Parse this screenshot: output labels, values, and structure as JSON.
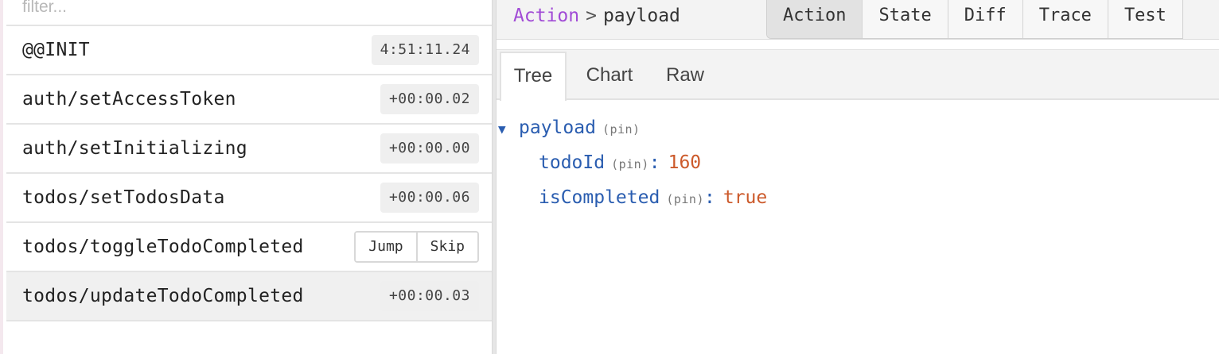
{
  "filter": {
    "placeholder": "filter..."
  },
  "actions": [
    {
      "name": "@@INIT",
      "time": "4:51:11.24"
    },
    {
      "name": "auth/setAccessToken",
      "time": "+00:00.02"
    },
    {
      "name": "auth/setInitializing",
      "time": "+00:00.00"
    },
    {
      "name": "todos/setTodosData",
      "time": "+00:00.06"
    },
    {
      "name": "todos/toggleTodoCompleted",
      "jump_label": "Jump",
      "skip_label": "Skip"
    },
    {
      "name": "todos/updateTodoCompleted",
      "time": "+00:00.03"
    }
  ],
  "breadcrumb": {
    "root": "Action",
    "separator": ">",
    "current": "payload"
  },
  "monitor_tabs": [
    "Action",
    "State",
    "Diff",
    "Trace",
    "Test"
  ],
  "sub_tabs": [
    "Tree",
    "Chart",
    "Raw"
  ],
  "tree": {
    "root": {
      "arrow": "▼",
      "key": "payload",
      "pin": "(pin)"
    },
    "children": [
      {
        "key": "todoId",
        "pin": "(pin)",
        "colon": ":",
        "value": "160"
      },
      {
        "key": "isCompleted",
        "pin": "(pin)",
        "colon": ":",
        "value": "true"
      }
    ]
  },
  "colors": {
    "breadcrumb_action": "#a14bd6",
    "tree_key": "#2a5db0",
    "tree_value": "#cc5a2b",
    "selected_row": "#f0f0f0"
  }
}
